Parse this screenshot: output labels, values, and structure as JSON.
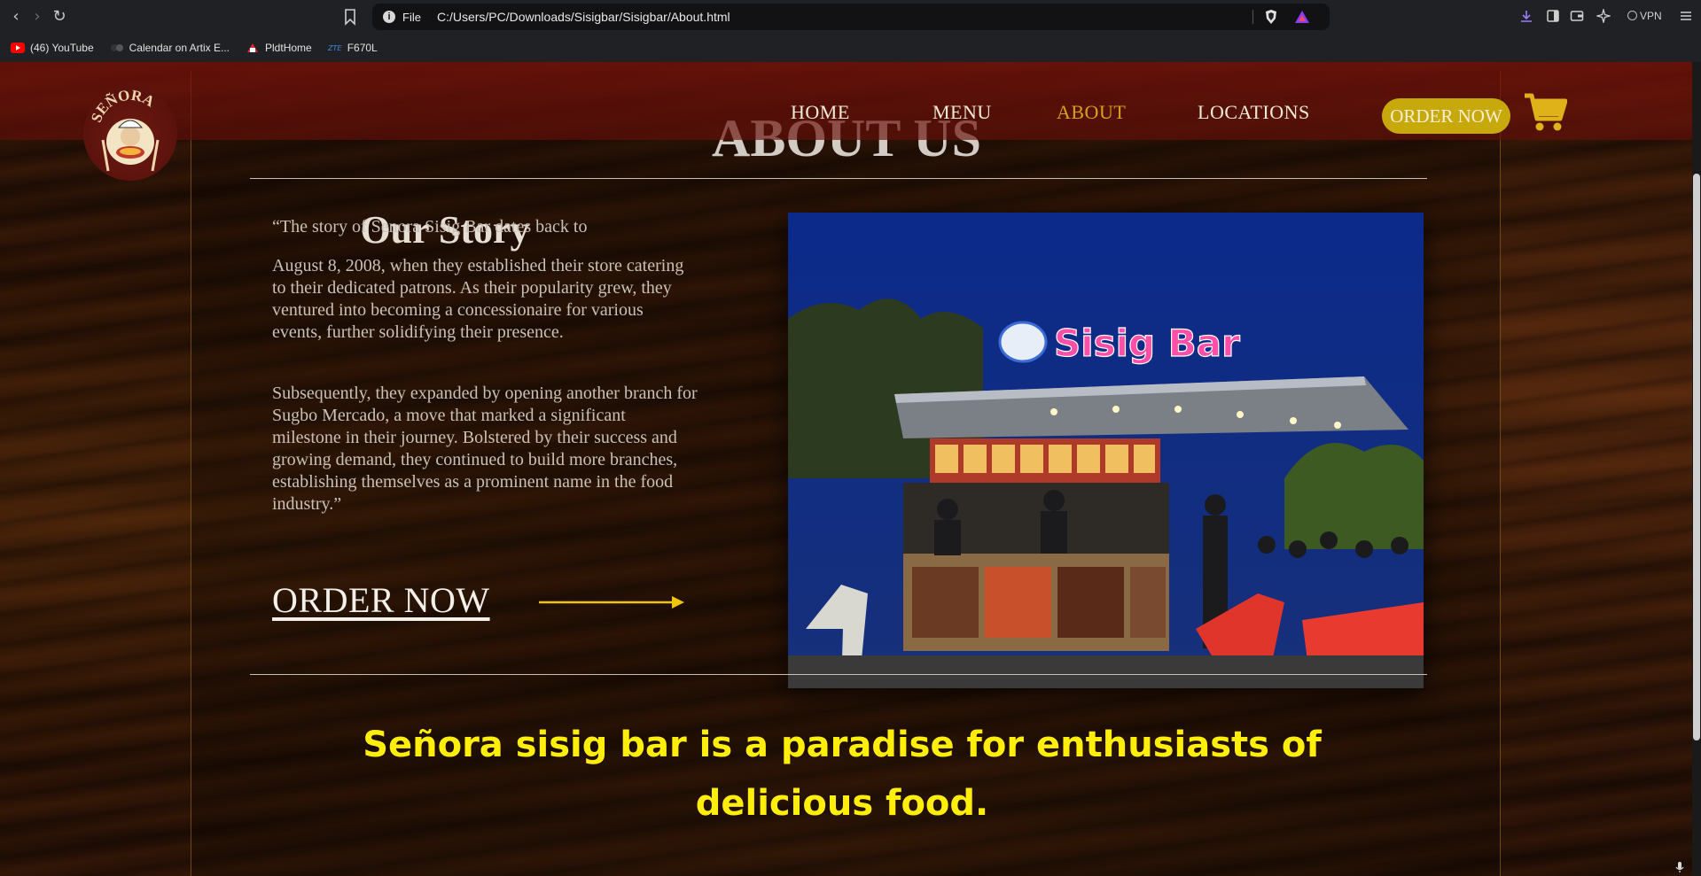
{
  "browser": {
    "url_scheme": "File",
    "url": "C:/Users/PC/Downloads/Sisigbar/Sisigbar/About.html",
    "vpn_label": "VPN",
    "bookmarks": [
      {
        "label": "(46) YouTube",
        "icon": "youtube-icon"
      },
      {
        "label": "Calendar on Artix E...",
        "icon": "artix-icon"
      },
      {
        "label": "PldtHome",
        "icon": "pldt-icon"
      },
      {
        "label": "F670L",
        "icon": "zte-icon"
      }
    ]
  },
  "site": {
    "logo_text": "SEÑORA",
    "nav": [
      {
        "label": "HOME"
      },
      {
        "label": "MENU"
      },
      {
        "label": "ABOUT",
        "active": true
      },
      {
        "label": "LOCATIONS"
      }
    ],
    "order_button": "ORDER NOW",
    "accent_color": "#d4a21c",
    "highlight_color": "#ffee0a"
  },
  "about": {
    "title": "ABOUT US",
    "story_heading": "Our Story",
    "paragraphs": [
      "“The story of Senora Sisig Bar dates back to",
      "August 8, 2008, when they established their store catering to their dedicated patrons. As their popularity grew, they ventured into becoming a concessionaire for various events, further solidifying their presence.",
      "Subsequently, they expanded by opening another branch for Sugbo Mercado, a move that marked a significant milestone in their journey. Bolstered by their success and growing demand, they continued to build more branches, establishing themselves as a prominent name in the food industry.”"
    ],
    "order_link": "ORDER NOW",
    "photo_sign": "Sisig Bar",
    "tagline": "Señora sisig bar is a paradise for enthusiasts of delicious food."
  }
}
